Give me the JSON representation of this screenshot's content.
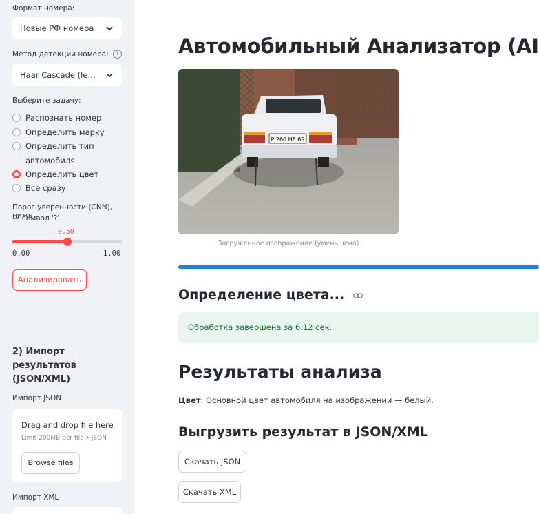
{
  "sidebar": {
    "plate_format_label": "Формат номера:",
    "plate_format_value": "Новые РФ номера",
    "detect_method_label": "Метод детекции номера:",
    "detect_method_value": "Haar Cascade (legacy)",
    "help_glyph": "?",
    "task_label": "Выберите задачу:",
    "tasks": [
      {
        "label": "Распознать номер",
        "selected": false
      },
      {
        "label": "Определить марку",
        "selected": false
      },
      {
        "label": "Определить тип",
        "selected": false
      },
      {
        "label": "автомобиля",
        "selected": false
      },
      {
        "label": "Определить цвет",
        "selected": true
      },
      {
        "label": "Всё сразу",
        "selected": false
      }
    ],
    "threshold_label_1": "Порог уверенности (CNN), ниже",
    "threshold_label_2": "— символ '?'",
    "threshold_value": "0.50",
    "threshold_min": "0.00",
    "threshold_max": "1.00",
    "threshold_fraction": 0.5,
    "analyze_button": "Анализировать",
    "import_header_1": "2) Импорт",
    "import_header_2": "результатов",
    "import_header_3": "(JSON/XML)",
    "import_json_label": "Импорт JSON",
    "uploader_title": "Drag and drop file here",
    "uploader_limit": "Limit 200MB per file • JSON",
    "browse_button": "Browse files",
    "import_xml_label": "Импорт XML"
  },
  "main": {
    "title": "Автомобильный Анализатор (AI)",
    "image_caption": "Загруженное изображение (уменьшено)",
    "progress_fraction": 1.0,
    "section_title": "Определение цвета...",
    "success_message": "Обработка завершена за 6.12 сек.",
    "results_title": "Результаты анализа",
    "result_key": "Цвет",
    "result_text": ": Основной цвет автомобиля на изображении — белый.",
    "export_title": "Выгрузить результат в JSON/XML",
    "download_json": "Скачать JSON",
    "download_xml": "Скачать XML",
    "plate_text": "Р 260 НЕ 69"
  },
  "colors": {
    "accent": "#ff4b4b",
    "progress": "#1c83e1",
    "sidebar_bg": "#f0f2f6",
    "success_bg": "#e8f6ee",
    "success_text": "#177233"
  }
}
